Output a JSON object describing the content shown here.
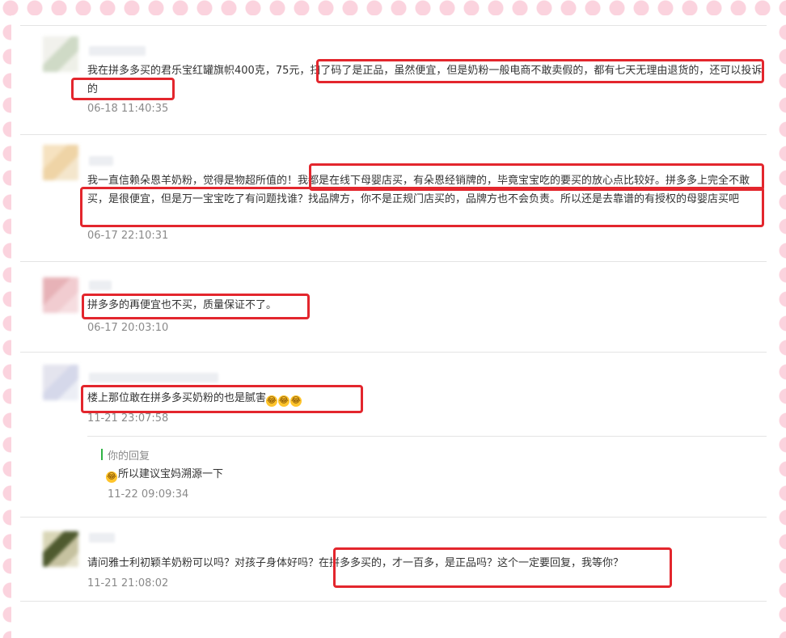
{
  "comments": [
    {
      "text": "我在拼多多买的君乐宝红罐旗帜400克，75元，扫了码了是正品，虽然便宜，但是奶粉一般电商不敢卖假的，都有七天无理由退货的，还可以投诉的",
      "time": "06-18 11:40:35"
    },
    {
      "text": "我一直信赖朵恩羊奶粉，觉得是物超所值的！我都是在线下母婴店买，有朵恩经销牌的，毕竟宝宝吃的要买的放心点比较好。拼多多上完全不敢买，是很便宜，但是万一宝宝吃了有问题找谁？找品牌方，你不是正规门店买的，品牌方也不会负责。所以还是去靠谱的有授权的母婴店买吧",
      "time": "06-17 22:10:31"
    },
    {
      "text": "拼多多的再便宜也不买，质量保证不了。",
      "time": "06-17 20:03:10"
    },
    {
      "text": "楼上那位敢在拼多多买奶粉的也是腻害",
      "emoji": [
        "laughing-tears-emoji",
        "laughing-tears-emoji",
        "laughing-tears-emoji"
      ],
      "time": "11-21 23:07:58",
      "reply": {
        "label": "你的回复",
        "text": "所以建议宝妈溯源一下",
        "emoji": "laughing-tears-emoji",
        "time": "11-22 09:09:34"
      }
    },
    {
      "text": "请问雅士利初颖羊奶粉可以吗？对孩子身体好吗？在拼多多买的，才一百多，是正品吗？这个一定要回复，我等你？",
      "time": "11-21 21:08:02"
    }
  ],
  "colors": {
    "highlight_box": "#e3262d",
    "timestamp": "#8a8a8a",
    "reply_bar": "#2fb344",
    "emoji": "#ffc42b"
  }
}
